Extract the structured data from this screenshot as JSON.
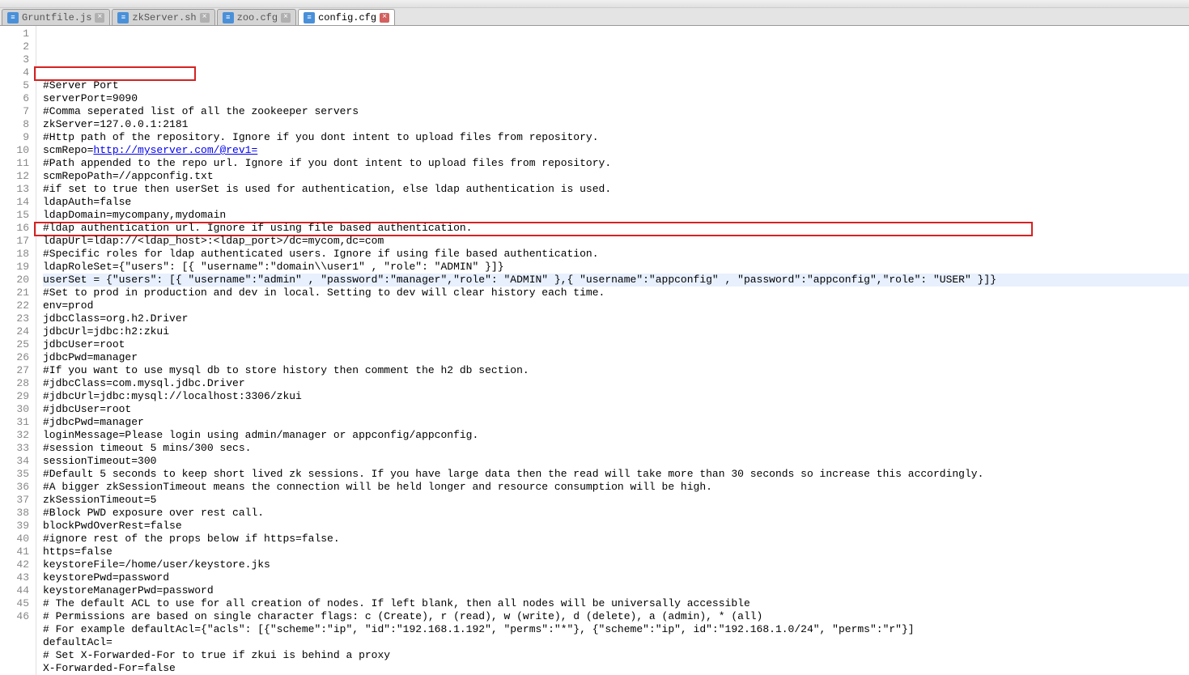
{
  "tabs": [
    {
      "label": "Gruntfile.js",
      "active": false
    },
    {
      "label": "zkServer.sh",
      "active": false
    },
    {
      "label": "zoo.cfg",
      "active": false
    },
    {
      "label": "config.cfg",
      "active": true
    }
  ],
  "lines": [
    {
      "num": 1,
      "text": "#Server Port"
    },
    {
      "num": 2,
      "text": "serverPort=9090"
    },
    {
      "num": 3,
      "text": "#Comma seperated list of all the zookeeper servers"
    },
    {
      "num": 4,
      "text": "zkServer=127.0.0.1:2181"
    },
    {
      "num": 5,
      "text": "#Http path of the repository. Ignore if you dont intent to upload files from repository."
    },
    {
      "num": 6,
      "text_prefix": "scmRepo=",
      "link": "http://myserver.com/@rev1="
    },
    {
      "num": 7,
      "text": "#Path appended to the repo url. Ignore if you dont intent to upload files from repository."
    },
    {
      "num": 8,
      "text": "scmRepoPath=//appconfig.txt"
    },
    {
      "num": 9,
      "text": "#if set to true then userSet is used for authentication, else ldap authentication is used."
    },
    {
      "num": 10,
      "text": "ldapAuth=false"
    },
    {
      "num": 11,
      "text": "ldapDomain=mycompany,mydomain"
    },
    {
      "num": 12,
      "text": "#ldap authentication url. Ignore if using file based authentication."
    },
    {
      "num": 13,
      "text": "ldapUrl=ldap://<ldap_host>:<ldap_port>/dc=mycom,dc=com"
    },
    {
      "num": 14,
      "text": "#Specific roles for ldap authenticated users. Ignore if using file based authentication."
    },
    {
      "num": 15,
      "text": "ldapRoleSet={\"users\": [{ \"username\":\"domain\\\\user1\" , \"role\": \"ADMIN\" }]}"
    },
    {
      "num": 16,
      "text": "userSet = {\"users\": [{ \"username\":\"admin\" , \"password\":\"manager\",\"role\": \"ADMIN\" },{ \"username\":\"appconfig\" , \"password\":\"appconfig\",\"role\": \"USER\" }]}",
      "highlighted": true
    },
    {
      "num": 17,
      "text": "#Set to prod in production and dev in local. Setting to dev will clear history each time."
    },
    {
      "num": 18,
      "text": "env=prod"
    },
    {
      "num": 19,
      "text": "jdbcClass=org.h2.Driver"
    },
    {
      "num": 20,
      "text": "jdbcUrl=jdbc:h2:zkui"
    },
    {
      "num": 21,
      "text": "jdbcUser=root"
    },
    {
      "num": 22,
      "text": "jdbcPwd=manager"
    },
    {
      "num": 23,
      "text": "#If you want to use mysql db to store history then comment the h2 db section."
    },
    {
      "num": 24,
      "text": "#jdbcClass=com.mysql.jdbc.Driver"
    },
    {
      "num": 25,
      "text": "#jdbcUrl=jdbc:mysql://localhost:3306/zkui"
    },
    {
      "num": 26,
      "text": "#jdbcUser=root"
    },
    {
      "num": 27,
      "text": "#jdbcPwd=manager"
    },
    {
      "num": 28,
      "text": "loginMessage=Please login using admin/manager or appconfig/appconfig."
    },
    {
      "num": 29,
      "text": "#session timeout 5 mins/300 secs."
    },
    {
      "num": 30,
      "text": "sessionTimeout=300"
    },
    {
      "num": 31,
      "text": "#Default 5 seconds to keep short lived zk sessions. If you have large data then the read will take more than 30 seconds so increase this accordingly."
    },
    {
      "num": 32,
      "text": "#A bigger zkSessionTimeout means the connection will be held longer and resource consumption will be high."
    },
    {
      "num": 33,
      "text": "zkSessionTimeout=5"
    },
    {
      "num": 34,
      "text": "#Block PWD exposure over rest call."
    },
    {
      "num": 35,
      "text": "blockPwdOverRest=false"
    },
    {
      "num": 36,
      "text": "#ignore rest of the props below if https=false."
    },
    {
      "num": 37,
      "text": "https=false"
    },
    {
      "num": 38,
      "text": "keystoreFile=/home/user/keystore.jks"
    },
    {
      "num": 39,
      "text": "keystorePwd=password"
    },
    {
      "num": 40,
      "text": "keystoreManagerPwd=password"
    },
    {
      "num": 41,
      "text": "# The default ACL to use for all creation of nodes. If left blank, then all nodes will be universally accessible"
    },
    {
      "num": 42,
      "text": "# Permissions are based on single character flags: c (Create), r (read), w (write), d (delete), a (admin), * (all)"
    },
    {
      "num": 43,
      "text": "# For example defaultAcl={\"acls\": [{\"scheme\":\"ip\", \"id\":\"192.168.1.192\", \"perms\":\"*\"}, {\"scheme\":\"ip\", id\":\"192.168.1.0/24\", \"perms\":\"r\"}]"
    },
    {
      "num": 44,
      "text": "defaultAcl="
    },
    {
      "num": 45,
      "text": "# Set X-Forwarded-For to true if zkui is behind a proxy"
    },
    {
      "num": 46,
      "text": "X-Forwarded-For=false"
    }
  ]
}
